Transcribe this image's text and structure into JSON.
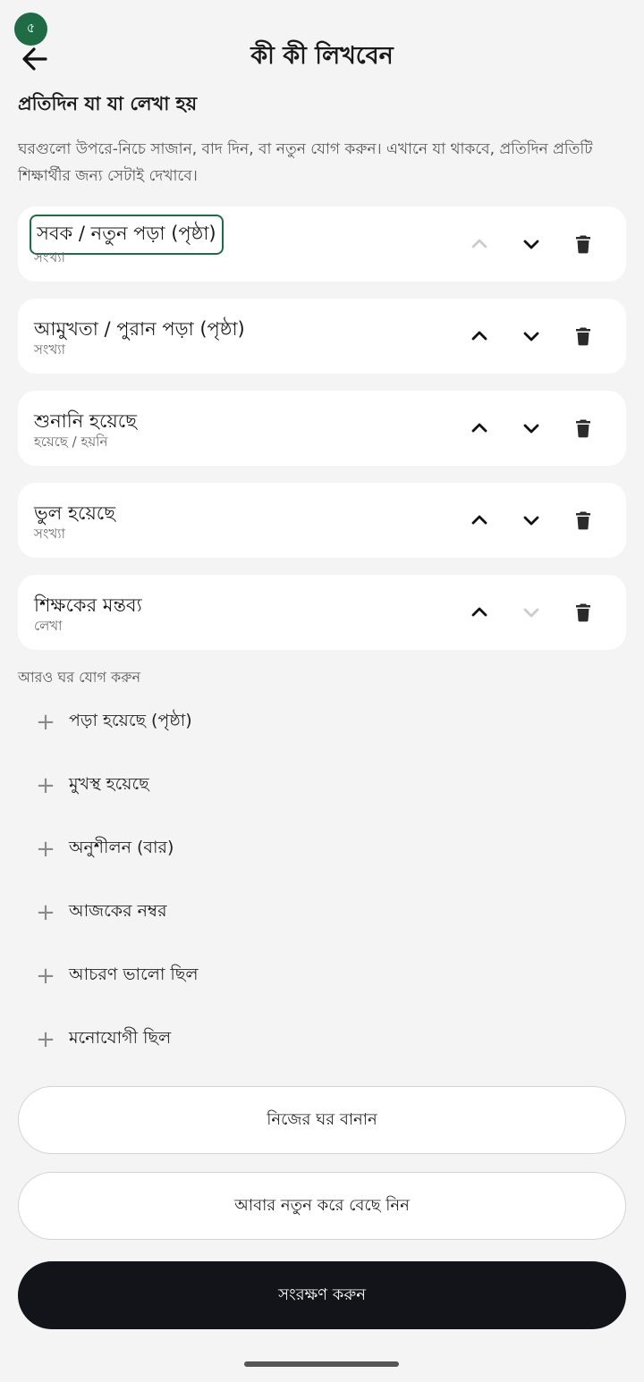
{
  "status_badge": "৫",
  "header": {
    "title": "কী কী লিখবেন"
  },
  "section": {
    "title": "প্রতিদিন যা যা লেখা হয়",
    "description": "ঘরগুলো উপরে-নিচে সাজান, বাদ দিন, বা নতুন যোগ করুন। এখানে যা থাকবে, প্রতিদিন প্রতিটি শিক্ষার্থীর জন্য সেটাই দেখাবে।"
  },
  "fields": [
    {
      "label": "সবক / নতুন পড়া (পৃষ্ঠা)",
      "type": "সংখ্যা",
      "up_enabled": false,
      "down_enabled": true,
      "focused": true
    },
    {
      "label": "আমুখতা / পুরান পড়া (পৃষ্ঠা)",
      "type": "সংখ্যা",
      "up_enabled": true,
      "down_enabled": true,
      "focused": false
    },
    {
      "label": "শুনানি হয়েছে",
      "type": "হয়েছে / হয়নি",
      "up_enabled": true,
      "down_enabled": true,
      "focused": false
    },
    {
      "label": "ভুল হয়েছে",
      "type": "সংখ্যা",
      "up_enabled": true,
      "down_enabled": true,
      "focused": false
    },
    {
      "label": "শিক্ষকের মন্তব্য",
      "type": "লেখা",
      "up_enabled": true,
      "down_enabled": false,
      "focused": false
    }
  ],
  "more": {
    "title": "আরও ঘর যোগ করুন",
    "items": [
      "পড়া হয়েছে (পৃষ্ঠা)",
      "মুখস্থ হয়েছে",
      "অনুশীলন (বার)",
      "আজকের নম্বর",
      "আচরণ ভালো ছিল",
      "মনোযোগী ছিল"
    ]
  },
  "buttons": {
    "custom": "নিজের ঘর বানান",
    "reset": "আবার নতুন করে বেছে নিন",
    "save": "সংরক্ষণ করুন"
  },
  "icons": {
    "back": "arrow-left-icon",
    "up": "chevron-up-icon",
    "down": "chevron-down-icon",
    "delete": "trash-icon",
    "add": "plus-icon"
  },
  "colors": {
    "accent": "#1f6b46",
    "primary_button": "#12141a",
    "background": "#f4f4f4",
    "disabled_icon": "#cccccc"
  }
}
